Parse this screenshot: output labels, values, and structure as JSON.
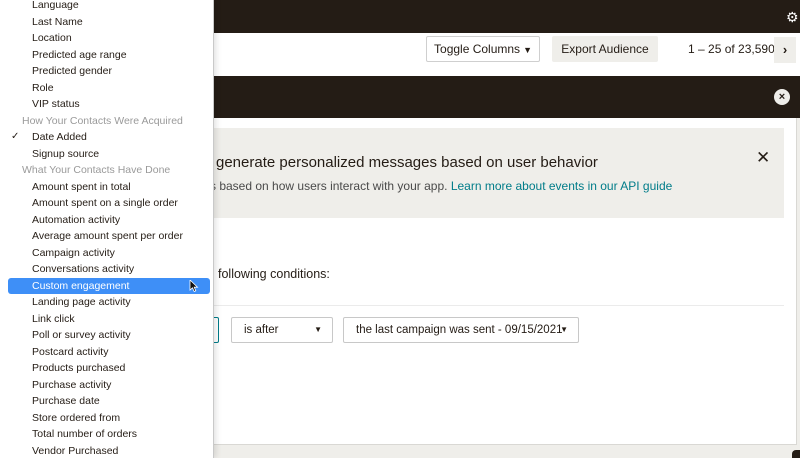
{
  "topbar": {
    "gear_icon": "gear-icon"
  },
  "toolbar": {
    "toggle_columns": "Toggle Columns",
    "export_audience": "Export Audience",
    "pagination": "1 – 25 of 23,590",
    "next_icon": "chevron-right-icon"
  },
  "banner": {
    "title": "generate personalized messages based on user behavior",
    "text_prefix": "s based on how users interact with your app.",
    "link": "Learn more about events in our API guide",
    "close_icon": "close-icon"
  },
  "segment": {
    "conditions_text": "following conditions:",
    "operator_value": "is after",
    "date_value": "the last campaign was sent - 09/15/2021"
  },
  "dropdown": {
    "items": [
      {
        "label": "Language",
        "kind": "item"
      },
      {
        "label": "Last Name",
        "kind": "item"
      },
      {
        "label": "Location",
        "kind": "item"
      },
      {
        "label": "Predicted age range",
        "kind": "item"
      },
      {
        "label": "Predicted gender",
        "kind": "item"
      },
      {
        "label": "Role",
        "kind": "item"
      },
      {
        "label": "VIP status",
        "kind": "item"
      },
      {
        "label": "How Your Contacts Were Acquired",
        "kind": "group"
      },
      {
        "label": "Date Added",
        "kind": "item",
        "checked": true
      },
      {
        "label": "Signup source",
        "kind": "item"
      },
      {
        "label": "What Your Contacts Have Done",
        "kind": "group"
      },
      {
        "label": "Amount spent in total",
        "kind": "item"
      },
      {
        "label": "Amount spent on a single order",
        "kind": "item"
      },
      {
        "label": "Automation activity",
        "kind": "item"
      },
      {
        "label": "Average amount spent per order",
        "kind": "item"
      },
      {
        "label": "Campaign activity",
        "kind": "item"
      },
      {
        "label": "Conversations activity",
        "kind": "item"
      },
      {
        "label": "Custom engagement",
        "kind": "item",
        "selected": true
      },
      {
        "label": "Landing page activity",
        "kind": "item"
      },
      {
        "label": "Link click",
        "kind": "item"
      },
      {
        "label": "Poll or survey activity",
        "kind": "item"
      },
      {
        "label": "Postcard activity",
        "kind": "item"
      },
      {
        "label": "Products purchased",
        "kind": "item"
      },
      {
        "label": "Purchase activity",
        "kind": "item"
      },
      {
        "label": "Purchase date",
        "kind": "item"
      },
      {
        "label": "Store ordered from",
        "kind": "item"
      },
      {
        "label": "Total number of orders",
        "kind": "item"
      },
      {
        "label": "Vendor Purchased",
        "kind": "item"
      }
    ]
  },
  "colors": {
    "dark": "#241c15",
    "highlight": "#3e8ff7",
    "link": "#007c89",
    "page_bg": "#efeeea"
  }
}
